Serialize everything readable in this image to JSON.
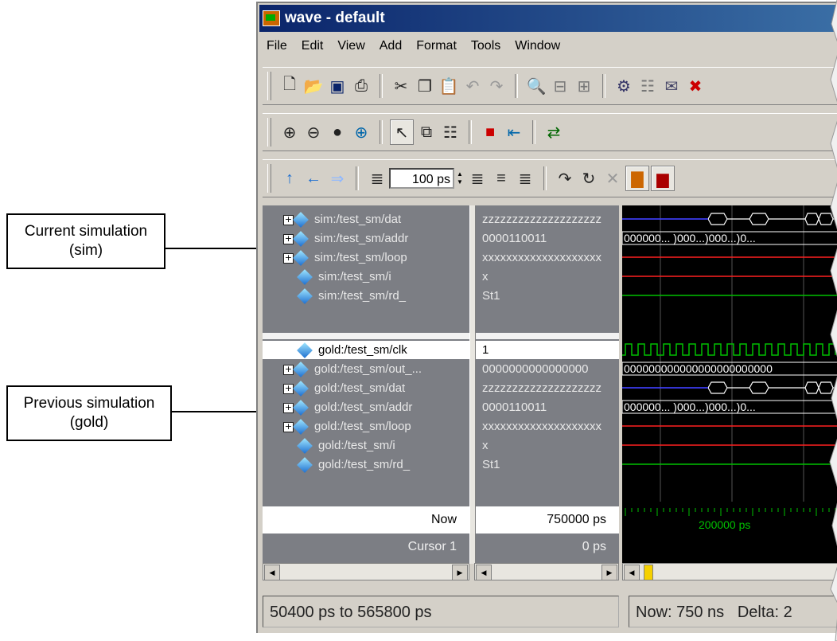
{
  "callouts": {
    "current": {
      "line1": "Current simulation",
      "line2": "(sim)"
    },
    "previous": {
      "line1": "Previous simulation",
      "line2": "(gold)"
    }
  },
  "window": {
    "title": "wave - default"
  },
  "menu": [
    "File",
    "Edit",
    "View",
    "Add",
    "Format",
    "Tools",
    "Window"
  ],
  "toolbar": {
    "row1": [
      "new-file-icon",
      "open-folder-icon",
      "save-icon",
      "print-icon",
      "cut-icon",
      "copy-icon",
      "paste-icon",
      "undo-icon",
      "redo-icon",
      "find-icon",
      "collapse-icon",
      "expand-icon",
      "compile-icon",
      "memory-icon",
      "script-icon",
      "delete-icon"
    ],
    "zoom_step": "100 ps"
  },
  "signals": [
    {
      "name": "sim:/test_sm/dat",
      "value": "zzzzzzzzzzzzzzzzzzzz",
      "expandable": true
    },
    {
      "name": "sim:/test_sm/addr",
      "value": "0000110011",
      "expandable": true
    },
    {
      "name": "sim:/test_sm/loop",
      "value": "xxxxxxxxxxxxxxxxxxxx",
      "expandable": true
    },
    {
      "name": "sim:/test_sm/i",
      "value": "x",
      "expandable": false
    },
    {
      "name": "sim:/test_sm/rd_",
      "value": "St1",
      "expandable": false
    },
    {
      "name": "gold:/test_sm/clk",
      "value": "1",
      "expandable": false,
      "selected": true
    },
    {
      "name": "gold:/test_sm/out_...",
      "value": "0000000000000000",
      "expandable": true
    },
    {
      "name": "gold:/test_sm/dat",
      "value": "zzzzzzzzzzzzzzzzzzzz",
      "expandable": true
    },
    {
      "name": "gold:/test_sm/addr",
      "value": "0000110011",
      "expandable": true
    },
    {
      "name": "gold:/test_sm/loop",
      "value": "xxxxxxxxxxxxxxxxxxxx",
      "expandable": true
    },
    {
      "name": "gold:/test_sm/i",
      "value": "x",
      "expandable": false
    },
    {
      "name": "gold:/test_sm/rd_",
      "value": "St1",
      "expandable": false
    }
  ],
  "wave_labels": {
    "addr": "000000... )000...)000...)0...",
    "out": "000000000000000000000000"
  },
  "now": {
    "label": "Now",
    "value": "750000 ps",
    "timeline": "200000 ps"
  },
  "cursor": {
    "label": "Cursor 1",
    "value": "0 ps"
  },
  "status": {
    "range": "50400 ps to 565800 ps",
    "now": "Now: 750 ns",
    "delta": "Delta: 2"
  },
  "colors": {
    "titlebar": "#0a246a",
    "wave_bg": "#000000",
    "signal_green": "#00c000",
    "bus_blue": "#3030ff",
    "unknown_red": "#ff2020"
  }
}
